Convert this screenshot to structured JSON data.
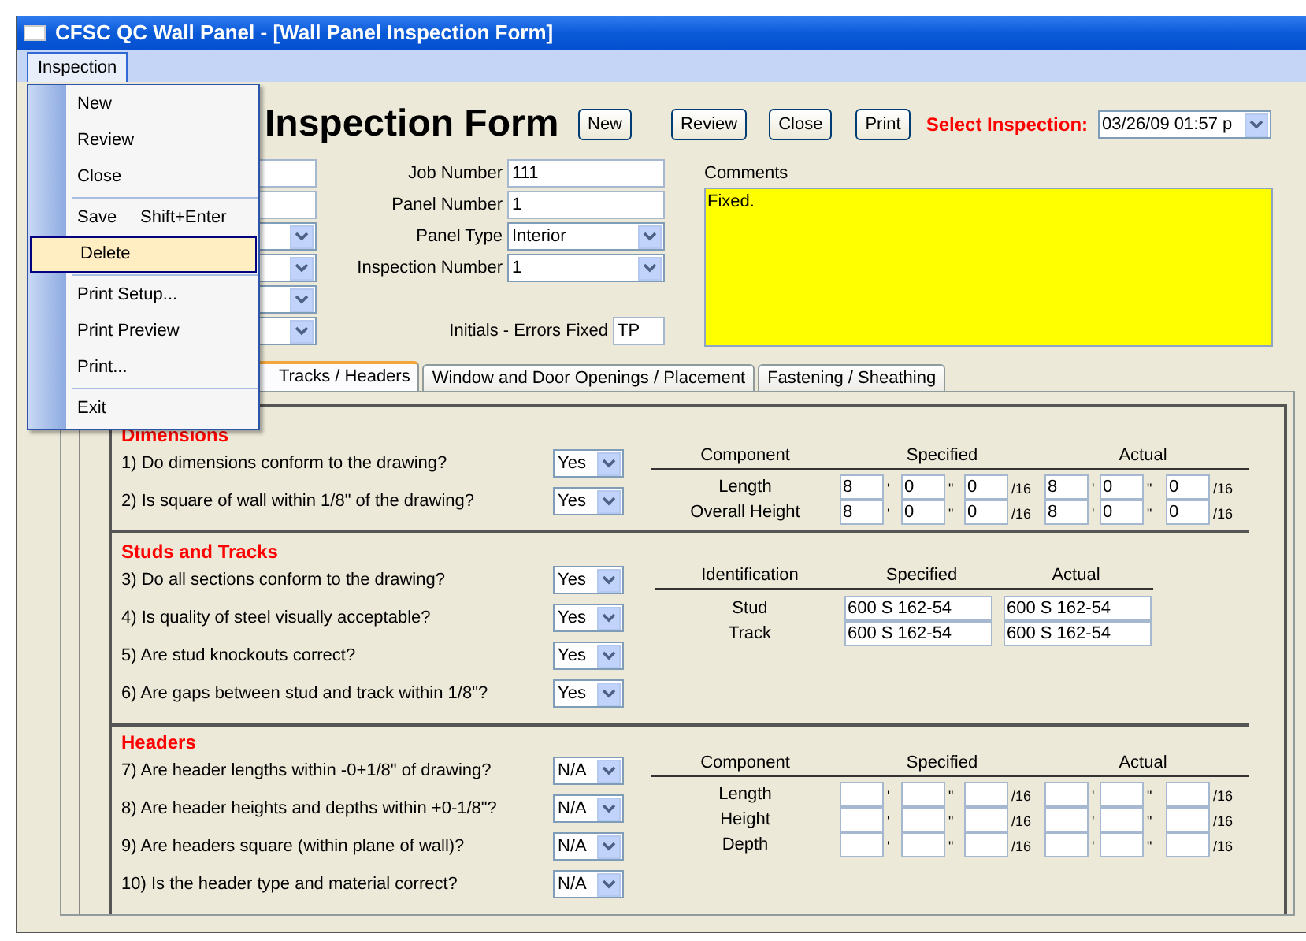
{
  "window": {
    "title": "CFSC QC Wall Panel - [Wall Panel Inspection Form]"
  },
  "menubar": {
    "items": [
      {
        "label": "Inspection",
        "selected": true
      }
    ]
  },
  "menu": {
    "items": [
      {
        "kind": "item",
        "label": "New",
        "highlighted": false
      },
      {
        "kind": "item",
        "label": "Review",
        "highlighted": false
      },
      {
        "kind": "item",
        "label": "Close",
        "highlighted": false
      },
      {
        "kind": "separator"
      },
      {
        "kind": "item",
        "label": "Save",
        "shortcut": "Shift+Enter",
        "highlighted": false
      },
      {
        "kind": "item",
        "label": "Delete",
        "highlighted": true
      },
      {
        "kind": "separator"
      },
      {
        "kind": "item",
        "label": "Print Setup...",
        "highlighted": false
      },
      {
        "kind": "item",
        "label": "Print Preview",
        "highlighted": false
      },
      {
        "kind": "item",
        "label": "Print...",
        "highlighted": false
      },
      {
        "kind": "separator"
      },
      {
        "kind": "item",
        "label": "Exit",
        "highlighted": false
      }
    ]
  },
  "form": {
    "title": "Inspection Form",
    "buttons": [
      "New",
      "Review",
      "Close",
      "Print"
    ],
    "select_inspection": {
      "label": "Select Inspection:",
      "value": "03/26/09 01:57 p"
    },
    "left_fields": [
      {
        "kind": "text"
      },
      {
        "kind": "text"
      },
      {
        "kind": "combo"
      },
      {
        "kind": "combo"
      },
      {
        "kind": "combo"
      },
      {
        "kind": "combo"
      }
    ],
    "fields": [
      {
        "label": "Job Number",
        "value": "111",
        "kind": "text"
      },
      {
        "label": "Panel Number",
        "value": "1",
        "kind": "text"
      },
      {
        "label": "Panel Type",
        "value": "Interior",
        "kind": "combo"
      },
      {
        "label": "Inspection Number",
        "value": "1",
        "kind": "combo"
      }
    ],
    "initials": {
      "label": "Initials - Errors Fixed",
      "value": "TP"
    },
    "comments": {
      "label": "Comments",
      "value": "Fixed."
    }
  },
  "tabs": [
    {
      "label": "Tracks / Headers",
      "selected": true
    },
    {
      "label": "Window and Door Openings / Placement",
      "selected": false
    },
    {
      "label": "Fastening / Sheathing",
      "selected": false
    }
  ],
  "sections": [
    {
      "heading": "Dimensions",
      "questions": [
        {
          "text": "1) Do dimensions conform to the drawing?",
          "answer": "Yes"
        },
        {
          "text": "2) Is square of wall within 1/8\" of the drawing?",
          "answer": "Yes"
        }
      ],
      "table": {
        "kind": "measure",
        "columns": [
          "Component",
          "Specified",
          "Actual"
        ],
        "rows": [
          {
            "label": "Length",
            "specified": [
              {
                "value": "8",
                "unit": "'"
              },
              {
                "value": "0",
                "unit": "\""
              },
              {
                "value": "0",
                "unit": "/16"
              }
            ],
            "actual": [
              {
                "value": "8",
                "unit": "'"
              },
              {
                "value": "0",
                "unit": "\""
              },
              {
                "value": "0",
                "unit": "/16"
              }
            ]
          },
          {
            "label": "Overall Height",
            "specified": [
              {
                "value": "8",
                "unit": "'"
              },
              {
                "value": "0",
                "unit": "\""
              },
              {
                "value": "0",
                "unit": "/16"
              }
            ],
            "actual": [
              {
                "value": "8",
                "unit": "'"
              },
              {
                "value": "0",
                "unit": "\""
              },
              {
                "value": "0",
                "unit": "/16"
              }
            ]
          }
        ]
      }
    },
    {
      "heading": "Studs and Tracks",
      "questions": [
        {
          "text": "3) Do all sections conform to the drawing?",
          "answer": "Yes"
        },
        {
          "text": "4) Is quality of steel visually acceptable?",
          "answer": "Yes"
        },
        {
          "text": "5) Are stud knockouts correct?",
          "answer": "Yes"
        },
        {
          "text": "6) Are gaps between stud and track within 1/8\"?",
          "answer": "Yes"
        }
      ],
      "table": {
        "kind": "ident",
        "columns": [
          "Identification",
          "Specified",
          "Actual"
        ],
        "rows": [
          {
            "label": "Stud",
            "specified": "600 S 162-54",
            "actual": "600 S 162-54"
          },
          {
            "label": "Track",
            "specified": "600 S 162-54",
            "actual": "600 S 162-54"
          }
        ]
      }
    },
    {
      "heading": "Headers",
      "questions": [
        {
          "text": "7) Are header lengths within -0+1/8\" of drawing?",
          "answer": "N/A"
        },
        {
          "text": "8) Are header heights and depths within +0-1/8\"?",
          "answer": "N/A"
        },
        {
          "text": "9) Are headers square (within plane of wall)?",
          "answer": "N/A"
        },
        {
          "text": "10) Is the header type and material correct?",
          "answer": "N/A"
        }
      ],
      "table": {
        "kind": "measure",
        "columns": [
          "Component",
          "Specified",
          "Actual"
        ],
        "rows": [
          {
            "label": "Length",
            "specified": [
              {
                "unit": "'"
              },
              {
                "unit": "\""
              },
              {
                "unit": "/16"
              }
            ],
            "actual": [
              {
                "unit": "'"
              },
              {
                "unit": "\""
              },
              {
                "unit": "/16"
              }
            ]
          },
          {
            "label": "Height",
            "specified": [
              {
                "unit": "'"
              },
              {
                "unit": "\""
              },
              {
                "unit": "/16"
              }
            ],
            "actual": [
              {
                "unit": "'"
              },
              {
                "unit": "\""
              },
              {
                "unit": "/16"
              }
            ]
          },
          {
            "label": "Depth",
            "specified": [
              {
                "unit": "'"
              },
              {
                "unit": "\""
              },
              {
                "unit": "/16"
              }
            ],
            "actual": [
              {
                "unit": "'"
              },
              {
                "unit": "\""
              },
              {
                "unit": "/16"
              }
            ]
          }
        ]
      }
    }
  ]
}
